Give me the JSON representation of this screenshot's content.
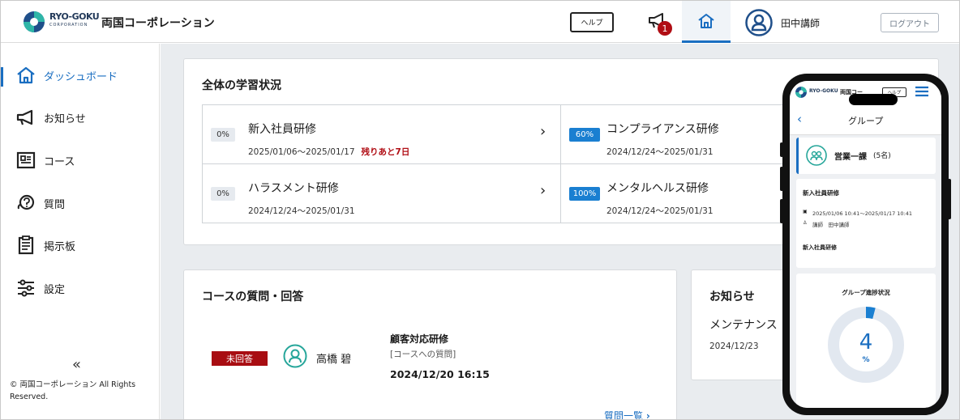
{
  "header": {
    "logo_text": "RYO-GOKU",
    "logo_sub": "CORPORATION",
    "company": "両国コーポレーション",
    "help_label": "ヘルプ",
    "notification_count": "1",
    "user_name": "田中講師",
    "logout_label": "ログアウト"
  },
  "sidebar": {
    "items": [
      {
        "label": "ダッシュボード",
        "icon": "home-icon"
      },
      {
        "label": "お知らせ",
        "icon": "megaphone-icon"
      },
      {
        "label": "コース",
        "icon": "course-icon"
      },
      {
        "label": "質問",
        "icon": "question-icon"
      },
      {
        "label": "掲示板",
        "icon": "board-icon"
      },
      {
        "label": "設定",
        "icon": "settings-icon"
      }
    ],
    "collapse_label": "«",
    "copyright": "© 両国コーポレーション All Rights Reserved."
  },
  "learning_status": {
    "title": "全体の学習状況",
    "courses": [
      {
        "percent": "0%",
        "name": "新入社員研修",
        "date": "2025/01/06～2025/01/17",
        "remaining": "残りあと7日"
      },
      {
        "percent": "60%",
        "name": "コンプライアンス研修",
        "date": "2024/12/24～2025/01/31",
        "remaining": ""
      },
      {
        "percent": "0%",
        "name": "ハラスメント研修",
        "date": "2024/12/24～2025/01/31",
        "remaining": ""
      },
      {
        "percent": "100%",
        "name": "メンタルヘルス研修",
        "date": "2024/12/24～2025/01/31",
        "remaining": ""
      }
    ]
  },
  "qa": {
    "title": "コースの質問・回答",
    "status": "未回答",
    "user": "高橋 碧",
    "course": "顧客対応研修",
    "tag": "[コースへの質問]",
    "datetime": "2024/12/20 16:15",
    "more_label": "質問一覧"
  },
  "news": {
    "title": "お知らせ",
    "item_title": "メンテナンス",
    "item_date": "2024/12/23"
  },
  "phone": {
    "header_logo": "RYO-GOKU",
    "header_company": "両国コー",
    "help_label": "ヘルプ",
    "page_title": "グループ",
    "group_name": "営業一課",
    "group_count": "(5名)",
    "course_title": "新入社員研修",
    "course_period": "2025/01/06 10:41～2025/01/17 10:41",
    "instructor": "講師　田中講師",
    "course_title2": "新入社員研修",
    "progress_title": "グループ進捗状況",
    "progress_value": "4",
    "progress_unit": "%",
    "progress_fraction": 0.04
  },
  "colors": {
    "accent": "#1a6ec1",
    "alert": "#b00d14",
    "badge_blue": "#1a7fd1"
  }
}
